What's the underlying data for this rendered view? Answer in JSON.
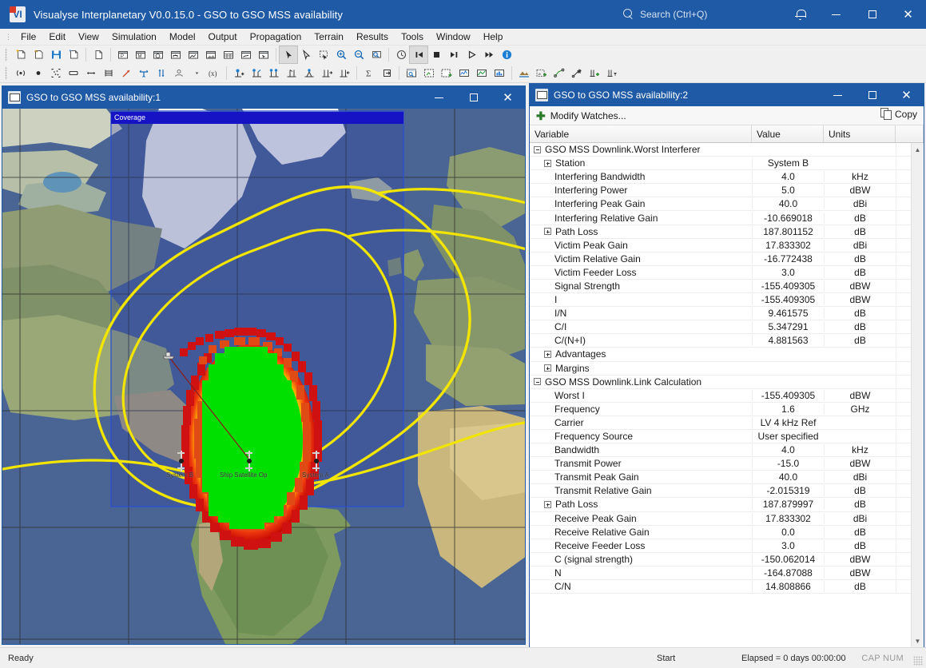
{
  "window": {
    "title": "Visualyse Interplanetary V0.0.15.0 - GSO to GSO MSS availability",
    "app_icon": "app-logo-icon",
    "search_placeholder": "Search (Ctrl+Q)",
    "controls": {
      "minimize": "–",
      "maximize": "□",
      "close": "✕"
    }
  },
  "menu": {
    "items": [
      {
        "label": "File"
      },
      {
        "label": "Edit"
      },
      {
        "label": "View"
      },
      {
        "label": "Simulation"
      },
      {
        "label": "Model"
      },
      {
        "label": "Output"
      },
      {
        "label": "Propagation"
      },
      {
        "label": "Terrain"
      },
      {
        "label": "Results"
      },
      {
        "label": "Tools"
      },
      {
        "label": "Window"
      },
      {
        "label": "Help"
      }
    ]
  },
  "toolbar_row1": {
    "groups": [
      {
        "buttons": [
          {
            "name": "new-document-icon"
          },
          {
            "name": "open-document-icon"
          },
          {
            "name": "save-icon"
          },
          {
            "name": "save-as-icon"
          }
        ]
      },
      {
        "buttons": [
          {
            "name": "copy-view-icon"
          }
        ]
      },
      {
        "buttons": [
          {
            "name": "new-plot-view-icon"
          },
          {
            "name": "new-map-view-icon"
          },
          {
            "name": "new-globe-view-icon"
          },
          {
            "name": "new-tree-view-icon"
          },
          {
            "name": "new-area-view-icon"
          },
          {
            "name": "new-image-view-icon"
          },
          {
            "name": "new-table-view-icon"
          },
          {
            "name": "new-watch-view-icon"
          },
          {
            "name": "new-select-view-icon"
          }
        ]
      },
      {
        "buttons": [
          {
            "name": "select-pointer-icon",
            "active": true
          },
          {
            "name": "pick-pointer-icon"
          },
          {
            "name": "rubber-band-select-icon"
          },
          {
            "name": "zoom-in-icon"
          },
          {
            "name": "zoom-out-icon"
          },
          {
            "name": "zoom-to-fit-icon"
          }
        ]
      },
      {
        "buttons": [
          {
            "name": "clock-icon"
          },
          {
            "name": "rewind-to-start-icon",
            "active": true
          },
          {
            "name": "stop-icon"
          },
          {
            "name": "step-icon"
          },
          {
            "name": "play-icon"
          },
          {
            "name": "fast-forward-icon"
          },
          {
            "name": "info-icon"
          }
        ]
      }
    ]
  },
  "toolbar_row2": {
    "groups": [
      {
        "buttons": [
          {
            "name": "transmitter-icon"
          },
          {
            "name": "point-station-icon"
          },
          {
            "name": "constellation-icon"
          },
          {
            "name": "area-icon"
          },
          {
            "name": "link-icon"
          },
          {
            "name": "list-icon"
          },
          {
            "name": "vector-icon"
          },
          {
            "name": "antenna-pattern-icon"
          },
          {
            "name": "traffic-icon"
          },
          {
            "name": "population-icon"
          },
          {
            "name": "dropdown-arrow-icon"
          },
          {
            "name": "variable-icon"
          }
        ]
      },
      {
        "buttons": [
          {
            "name": "add-station-icon"
          },
          {
            "name": "link-group-1-icon"
          },
          {
            "name": "link-group-2-icon"
          },
          {
            "name": "link-group-3-icon"
          },
          {
            "name": "link-group-4-icon"
          },
          {
            "name": "link-group-5-icon"
          },
          {
            "name": "link-group-6-icon"
          }
        ]
      },
      {
        "buttons": [
          {
            "name": "sum-icon"
          },
          {
            "name": "export-icon"
          }
        ]
      },
      {
        "buttons": [
          {
            "name": "watch-window-icon"
          },
          {
            "name": "area-analysis-icon"
          },
          {
            "name": "add-area-analysis-icon"
          },
          {
            "name": "time-plot-icon"
          },
          {
            "name": "result-plot-icon"
          },
          {
            "name": "histogram-icon"
          }
        ]
      },
      {
        "buttons": [
          {
            "name": "terrain-icon"
          },
          {
            "name": "terrain-add-icon"
          },
          {
            "name": "path-profile-icon"
          },
          {
            "name": "path-point-icon"
          },
          {
            "name": "add-database-icon"
          },
          {
            "name": "filter-database-icon"
          }
        ]
      }
    ]
  },
  "map_window": {
    "title": "GSO to GSO MSS availability:1",
    "icon": "map-view-icon",
    "controls": {
      "minimize": "–",
      "maximize": "□",
      "close": "✕"
    },
    "coverage_label": "Coverage",
    "stations": [
      {
        "name": "System B",
        "label": "System B"
      },
      {
        "name": "Ship Satellite Op",
        "label": "Ship Satellite Op"
      },
      {
        "name": "System A",
        "label": "System A"
      }
    ]
  },
  "watch_window": {
    "title": "GSO to GSO MSS availability:2",
    "icon": "watch-view-icon",
    "controls": {
      "minimize": "–",
      "maximize": "□",
      "close": "✕"
    },
    "modify_watches_label": "Modify Watches...",
    "copy_label": "Copy",
    "columns": [
      "Variable",
      "Value",
      "Units"
    ],
    "rows": [
      {
        "indent": 0,
        "expander": "expanded",
        "variable": "GSO MSS Downlink.Worst Interferer",
        "value": "",
        "units": ""
      },
      {
        "indent": 1,
        "expander": "collapsed",
        "variable": "Station",
        "value": "System B",
        "units": ""
      },
      {
        "indent": 2,
        "expander": "none",
        "variable": "Interfering Bandwidth",
        "value": "4.0",
        "units": "kHz"
      },
      {
        "indent": 2,
        "expander": "none",
        "variable": "Interfering Power",
        "value": "5.0",
        "units": "dBW"
      },
      {
        "indent": 2,
        "expander": "none",
        "variable": "Interfering Peak Gain",
        "value": "40.0",
        "units": "dBi"
      },
      {
        "indent": 2,
        "expander": "none",
        "variable": "Interfering Relative Gain",
        "value": "-10.669018",
        "units": "dB"
      },
      {
        "indent": 1,
        "expander": "collapsed",
        "variable": "Path Loss",
        "value": "187.801152",
        "units": "dB"
      },
      {
        "indent": 2,
        "expander": "none",
        "variable": "Victim Peak Gain",
        "value": "17.833302",
        "units": "dBi"
      },
      {
        "indent": 2,
        "expander": "none",
        "variable": "Victim Relative Gain",
        "value": "-16.772438",
        "units": "dB"
      },
      {
        "indent": 2,
        "expander": "none",
        "variable": "Victim Feeder Loss",
        "value": "3.0",
        "units": "dB"
      },
      {
        "indent": 2,
        "expander": "none",
        "variable": "Signal Strength",
        "value": "-155.409305",
        "units": "dBW"
      },
      {
        "indent": 2,
        "expander": "none",
        "variable": "I",
        "value": "-155.409305",
        "units": "dBW"
      },
      {
        "indent": 2,
        "expander": "none",
        "variable": "I/N",
        "value": "9.461575",
        "units": "dB"
      },
      {
        "indent": 2,
        "expander": "none",
        "variable": "C/I",
        "value": "5.347291",
        "units": "dB"
      },
      {
        "indent": 2,
        "expander": "none",
        "variable": "C/(N+I)",
        "value": "4.881563",
        "units": "dB"
      },
      {
        "indent": 1,
        "expander": "collapsed",
        "variable": "Advantages",
        "value": "",
        "units": ""
      },
      {
        "indent": 1,
        "expander": "collapsed",
        "variable": "Margins",
        "value": "",
        "units": ""
      },
      {
        "indent": 0,
        "expander": "expanded",
        "variable": "GSO MSS Downlink.Link Calculation",
        "value": "",
        "units": ""
      },
      {
        "indent": 2,
        "expander": "none",
        "variable": "Worst I",
        "value": "-155.409305",
        "units": "dBW"
      },
      {
        "indent": 2,
        "expander": "none",
        "variable": "Frequency",
        "value": "1.6",
        "units": "GHz"
      },
      {
        "indent": 2,
        "expander": "none",
        "variable": "Carrier",
        "value": "LV 4 kHz Ref",
        "units": ""
      },
      {
        "indent": 2,
        "expander": "none",
        "variable": "Frequency Source",
        "value": "User specified",
        "units": ""
      },
      {
        "indent": 2,
        "expander": "none",
        "variable": "Bandwidth",
        "value": "4.0",
        "units": "kHz"
      },
      {
        "indent": 2,
        "expander": "none",
        "variable": "Transmit Power",
        "value": "-15.0",
        "units": "dBW"
      },
      {
        "indent": 2,
        "expander": "none",
        "variable": "Transmit Peak Gain",
        "value": "40.0",
        "units": "dBi"
      },
      {
        "indent": 2,
        "expander": "none",
        "variable": "Transmit Relative Gain",
        "value": "-2.015319",
        "units": "dB"
      },
      {
        "indent": 1,
        "expander": "collapsed",
        "variable": "Path Loss",
        "value": "187.879997",
        "units": "dB"
      },
      {
        "indent": 2,
        "expander": "none",
        "variable": "Receive Peak Gain",
        "value": "17.833302",
        "units": "dBi"
      },
      {
        "indent": 2,
        "expander": "none",
        "variable": "Receive Relative Gain",
        "value": "0.0",
        "units": "dB"
      },
      {
        "indent": 2,
        "expander": "none",
        "variable": "Receive Feeder Loss",
        "value": "3.0",
        "units": "dB"
      },
      {
        "indent": 2,
        "expander": "none",
        "variable": "C (signal strength)",
        "value": "-150.062014",
        "units": "dBW"
      },
      {
        "indent": 2,
        "expander": "none",
        "variable": "N",
        "value": "-164.87088",
        "units": "dBW"
      },
      {
        "indent": 2,
        "expander": "none",
        "variable": "C/N",
        "value": "14.808866",
        "units": "dB"
      }
    ]
  },
  "statusbar": {
    "ready": "Ready",
    "start": "Start",
    "elapsed": "Elapsed = 0 days 00:00:00",
    "caps": "CAP NUM"
  },
  "colors": {
    "title_blue": "#1f5aa6",
    "contour_yellow": "#f2e500",
    "coverage_blue": "#1613c4",
    "heat_green": "#00e000",
    "heat_red": "#d81010",
    "ocean": "#4a6594"
  }
}
